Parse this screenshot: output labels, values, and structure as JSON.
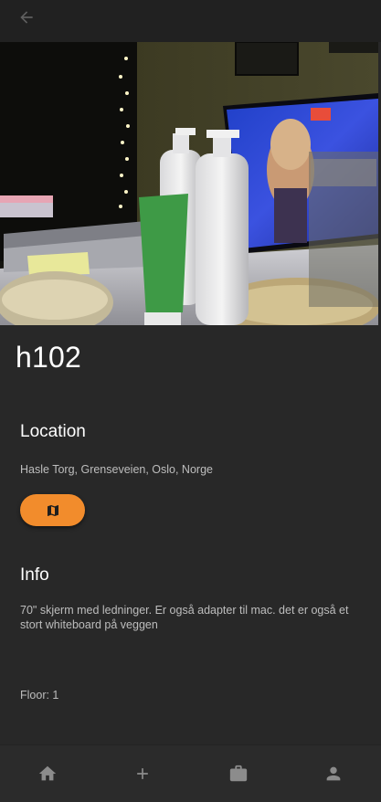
{
  "room": {
    "name": "h102",
    "photo_alt": "Room photo"
  },
  "location": {
    "heading": "Location",
    "address": "Hasle Torg, Grenseveien, Oslo, Norge",
    "map_icon": "map-icon"
  },
  "info": {
    "heading": "Info",
    "description": "70\" skjerm med ledninger. Er også adapter til mac. det er også et stort whiteboard på veggen",
    "floor": "Floor: 1"
  },
  "nav": {
    "items": [
      "home-icon",
      "add-icon",
      "briefcase-icon",
      "person-icon"
    ]
  },
  "colors": {
    "accent": "#f28c2c",
    "background": "#282828",
    "topbar": "#212121",
    "icon_muted": "#8c8c8c"
  }
}
